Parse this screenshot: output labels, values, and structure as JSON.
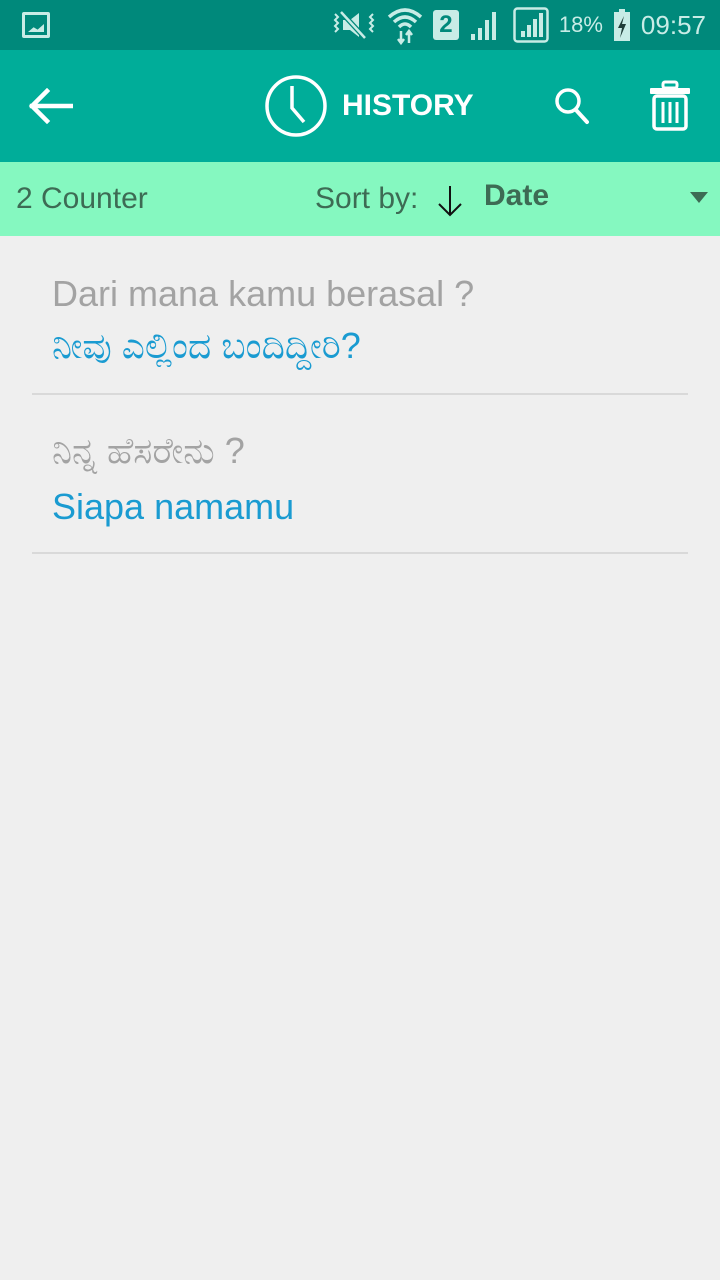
{
  "status_bar": {
    "battery_percent": "18%",
    "time": "09:57",
    "sim_slot": "2",
    "icons": [
      "gallery-notification-icon",
      "vibrate-mute-icon",
      "wifi-icon",
      "sim-2-icon",
      "signal-icon",
      "signal-box-icon",
      "battery-charging-icon"
    ]
  },
  "app_bar": {
    "title": "HISTORY",
    "icons": [
      "back-arrow-icon",
      "clock-icon",
      "search-icon",
      "trash-icon"
    ]
  },
  "sort_bar": {
    "counter": "2 Counter",
    "sort_label": "Sort by:",
    "sort_direction": "descending",
    "sort_value": "Date"
  },
  "history": {
    "items": [
      {
        "source": "Dari mana kamu berasal ?",
        "translation": "ನೀವು ಎಲ್ಲಿಂದ ಬಂದಿದ್ದೀರಿ?"
      },
      {
        "source": "ನಿನ್ನ ಹೆಸರೇನು ?",
        "translation": "Siapa namamu"
      }
    ]
  },
  "colors": {
    "status_bar": "#00897b",
    "app_bar": "#00ad99",
    "sort_bar": "#85f8c0",
    "background": "#efefef",
    "source_text": "#a3a3a3",
    "translation_text": "#1a9bd1"
  }
}
